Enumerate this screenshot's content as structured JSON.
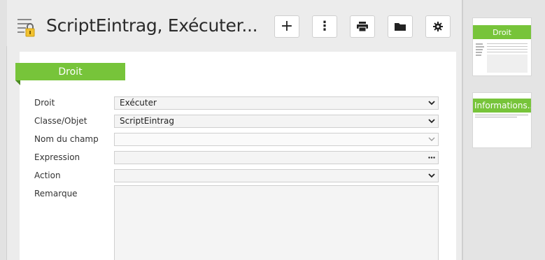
{
  "header": {
    "title": "ScriptEintrag, Exécuter...",
    "icon": "document-lock-icon",
    "toolbar": [
      {
        "name": "add-button",
        "icon": "plus-icon",
        "glyph": "+"
      },
      {
        "name": "more-options-button",
        "icon": "vertical-ellipsis-icon",
        "glyph": "⋮"
      },
      {
        "name": "print-button",
        "icon": "printer-icon"
      },
      {
        "name": "folder-button",
        "icon": "folder-icon"
      },
      {
        "name": "settings-button",
        "icon": "gear-icon"
      }
    ]
  },
  "section": {
    "title": "Droit"
  },
  "form": {
    "fields": [
      {
        "label": "Droit",
        "value": "Exécuter",
        "control": "dropdown"
      },
      {
        "label": "Classe/Objet",
        "value": "ScriptEintrag",
        "control": "dropdown"
      },
      {
        "label": "Nom du champ",
        "value": "",
        "control": "dropdown-disabled"
      },
      {
        "label": "Expression",
        "value": "",
        "control": "ellipsis"
      },
      {
        "label": "Action",
        "value": "",
        "control": "dropdown"
      },
      {
        "label": "Remarque",
        "value": "",
        "control": "textarea"
      }
    ]
  },
  "sidebar": {
    "thumbnails": [
      {
        "title": "Droit"
      },
      {
        "title": "Informations..."
      }
    ]
  },
  "colors": {
    "accent": "#77c43a",
    "accent_dark": "#4c8a22",
    "background": "#ececec",
    "panel": "#ffffff"
  }
}
